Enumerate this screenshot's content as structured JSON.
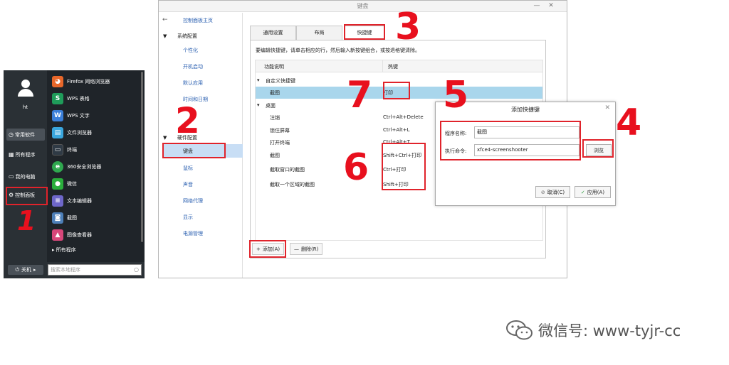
{
  "start_menu": {
    "username": "ht",
    "left_items": [
      {
        "label": "常用软件",
        "icon": "clock-icon"
      },
      {
        "label": "所有程序",
        "icon": "grid-icon"
      },
      {
        "label": "我的电脑",
        "icon": "monitor-icon"
      },
      {
        "label": "控制面板",
        "icon": "gear-icon"
      }
    ],
    "apps": [
      {
        "label": "Firefox 网络浏览器",
        "color": "#e8672a",
        "glyph": "◕"
      },
      {
        "label": "WPS 表格",
        "color": "#1f9c5a",
        "glyph": "S"
      },
      {
        "label": "WPS 文字",
        "color": "#3b7fd8",
        "glyph": "W"
      },
      {
        "label": "文件浏览器",
        "color": "#3aa6dd",
        "glyph": "▤"
      },
      {
        "label": "终端",
        "color": "#2f3a45",
        "glyph": "▭"
      },
      {
        "label": "360安全浏览器",
        "color": "#2fa84f",
        "glyph": "e"
      },
      {
        "label": "微信",
        "color": "#2aae3c",
        "glyph": "●"
      },
      {
        "label": "文本编辑器",
        "color": "#6e67c9",
        "glyph": "≡"
      },
      {
        "label": "截图",
        "color": "#4d7fb8",
        "glyph": "◙"
      },
      {
        "label": "图像查看器",
        "color": "#d8477a",
        "glyph": "▲"
      }
    ],
    "all_programs": "所有程序",
    "shutdown": "关机",
    "search_placeholder": "搜索本地程序"
  },
  "window": {
    "title": "键盘",
    "sidebar": {
      "home": "控制面板主页",
      "system_category": "系统配置",
      "system_items": [
        "个性化",
        "开机启动",
        "默认应用",
        "时间和日期"
      ],
      "hardware_category": "硬件配置",
      "hardware_items": [
        "键盘",
        "鼠标",
        "声音",
        "网络代理",
        "显示",
        "电源管理"
      ]
    },
    "tabs": [
      "通用设置",
      "布局",
      "快捷键"
    ],
    "hint": "要编辑快捷键，请单击相应的行，然后输入新按键组合，或按退格键清除。",
    "columns": [
      "功能说明",
      "热键"
    ],
    "rows": [
      {
        "name": "自定义快捷键",
        "key": "",
        "group": true
      },
      {
        "name": "截图",
        "key": "打印",
        "group": false
      },
      {
        "name": "桌面",
        "key": "",
        "group": true
      },
      {
        "name": "注销",
        "key": "Ctrl+Alt+Delete",
        "group": false
      },
      {
        "name": "锁住屏幕",
        "key": "Ctrl+Alt+L",
        "group": false
      },
      {
        "name": "打开终端",
        "key": "Ctrl+Alt+T",
        "group": false
      },
      {
        "name": "截图",
        "key": "Shift+Ctrl+打印",
        "group": false
      },
      {
        "name": "截取窗口的截图",
        "key": "Ctrl+打印",
        "group": false
      },
      {
        "name": "截取一个区域的截图",
        "key": "Shift+打印",
        "group": false
      }
    ],
    "add_button": "添加(A)",
    "delete_button": "删除(R)"
  },
  "dialog": {
    "title": "添加快捷键",
    "name_label": "程序名称:",
    "name_value": "截图",
    "command_label": "执行命令:",
    "command_value": "xfce4-screenshooter",
    "browse": "浏览",
    "cancel": "取消(C)",
    "apply": "应用(A)"
  },
  "annotations": [
    "1",
    "2",
    "3",
    "4",
    "5",
    "6",
    "7"
  ],
  "watermark": "微信号: www-tyjr-cc",
  "colors": {
    "annotation_red": "#e0232b",
    "selection_blue": "#a9d6ec",
    "link_blue": "#2a5fb0"
  }
}
